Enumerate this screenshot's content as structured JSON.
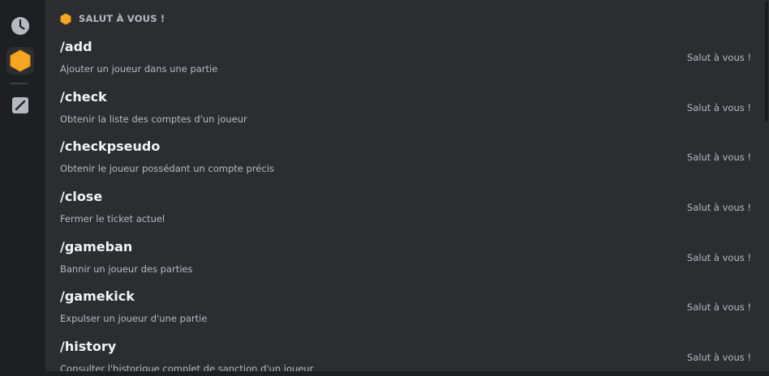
{
  "section": {
    "title": "SALUT À VOUS !"
  },
  "rail": {
    "items": [
      {
        "name": "recent",
        "icon": "clock-icon"
      },
      {
        "name": "app",
        "icon": "hexagon-icon",
        "color": "#f0a020"
      },
      {
        "name": "builtin",
        "icon": "slash-icon"
      }
    ]
  },
  "commands": [
    {
      "name": "/add",
      "description": "Ajouter un joueur dans une partie",
      "app": "Salut à vous !"
    },
    {
      "name": "/check",
      "description": "Obtenir la liste des comptes d'un joueur",
      "app": "Salut à vous !"
    },
    {
      "name": "/checkpseudo",
      "description": "Obtenir le joueur possédant un compte précis",
      "app": "Salut à vous !"
    },
    {
      "name": "/close",
      "description": "Fermer le ticket actuel",
      "app": "Salut à vous !"
    },
    {
      "name": "/gameban",
      "description": "Bannir un joueur des parties",
      "app": "Salut à vous !"
    },
    {
      "name": "/gamekick",
      "description": "Expulser un joueur d'une partie",
      "app": "Salut à vous !"
    },
    {
      "name": "/history",
      "description": "Consulter l'historique complet de sanction d'un joueur",
      "app": "Salut à vous !"
    }
  ],
  "colors": {
    "accent": "#f0a020",
    "background": "#2b2d31",
    "rail": "#1e1f22"
  }
}
